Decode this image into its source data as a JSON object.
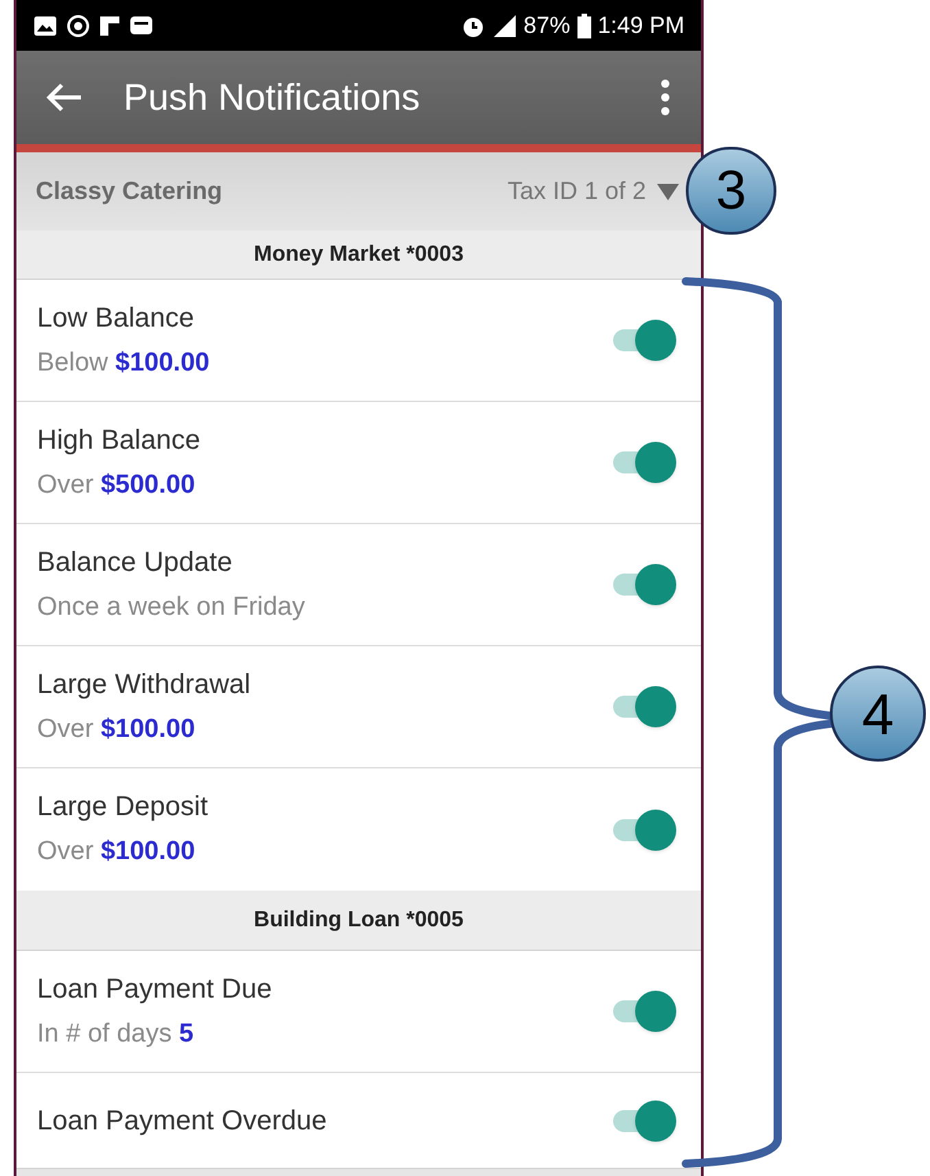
{
  "status_bar": {
    "battery": "87%",
    "time": "1:49 PM"
  },
  "toolbar": {
    "title": "Push Notifications"
  },
  "account_bar": {
    "name": "Classy Catering",
    "tax_id": "Tax ID 1 of 2"
  },
  "sections": [
    {
      "title": "Money Market *0003",
      "alerts": [
        {
          "name": "Low Balance",
          "detail": "Below",
          "value": "$100.00",
          "on": true
        },
        {
          "name": "High Balance",
          "detail": "Over",
          "value": "$500.00",
          "on": true
        },
        {
          "name": "Balance Update",
          "detail": "Once a week on Friday",
          "on": true
        },
        {
          "name": "Large Withdrawal",
          "detail": "Over",
          "value": "$100.00",
          "on": true
        },
        {
          "name": "Large Deposit",
          "detail": "Over",
          "value": "$100.00",
          "on": true
        }
      ]
    },
    {
      "title": "Building Loan *0005",
      "alerts": [
        {
          "name": "Loan Payment Due",
          "detail": "In # of days",
          "value": "5",
          "on": true
        },
        {
          "name": "Loan Payment Overdue",
          "on": true
        }
      ]
    }
  ],
  "callouts": [
    "3",
    "4"
  ]
}
